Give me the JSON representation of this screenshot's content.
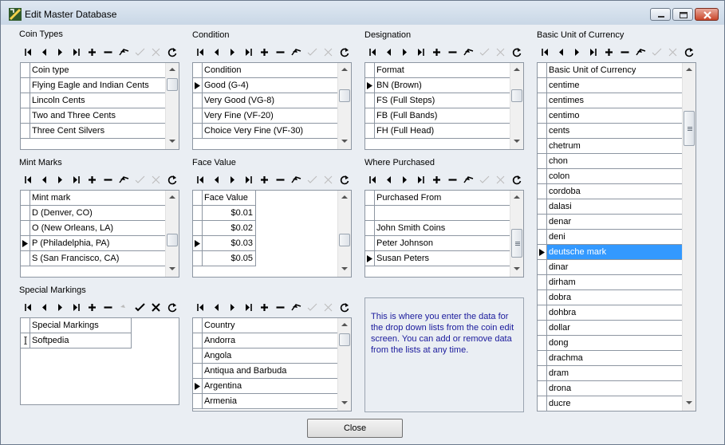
{
  "window": {
    "title": "Edit Master Database"
  },
  "panels": {
    "coin_types": {
      "label": "Coin Types",
      "header": "Coin type",
      "rows": [
        "Flying Eagle and Indian Cents",
        "Lincoln Cents",
        "Two and Three Cents",
        "Three Cent Silvers"
      ],
      "current_row": -1
    },
    "condition": {
      "label": "Condition",
      "header": "Condition",
      "rows": [
        "Good (G-4)",
        "Very Good (VG-8)",
        "Very Fine (VF-20)",
        "Choice Very Fine (VF-30)"
      ],
      "current_row": 0
    },
    "designation": {
      "label": "Designation",
      "header": "Format",
      "rows": [
        "BN (Brown)",
        "FS (Full Steps)",
        "FB (Full Bands)",
        "FH (Full Head)"
      ],
      "current_row": 0
    },
    "mint_marks": {
      "label": "Mint Marks",
      "header": "Mint mark",
      "rows": [
        "D (Denver, CO)",
        "O (New Orleans, LA)",
        "P (Philadelphia, PA)",
        "S (San Francisco, CA)"
      ],
      "current_row": 2
    },
    "face_value": {
      "label": "Face Value",
      "header": "Face Value",
      "rows": [
        "$0.01",
        "$0.02",
        "$0.03",
        "$0.05"
      ],
      "current_row": 2
    },
    "where_purchased": {
      "label": "Where Purchased",
      "header": "Purchased From",
      "rows": [
        "",
        "John Smith Coins",
        "Peter Johnson",
        "Susan Peters"
      ],
      "current_row": 3
    },
    "special_markings": {
      "label": "Special Markings",
      "header": "Special Markings",
      "rows": [
        "Softpedia"
      ],
      "current_row": 0
    },
    "country": {
      "label": "",
      "header": "Country",
      "rows": [
        "Andorra",
        "Angola",
        "Antiqua and Barbuda",
        "Argentina",
        "Armenia"
      ],
      "current_row": 3
    },
    "currency": {
      "label": "Basic Unit of Currency",
      "header": "Basic Unit of Currency",
      "rows": [
        "centime",
        "centimes",
        "centimo",
        "cents",
        "chetrum",
        "chon",
        "colon",
        "cordoba",
        "dalasi",
        "denar",
        "deni",
        "deutsche mark",
        "dinar",
        "dirham",
        "dobra",
        "dohbra",
        "dollar",
        "dong",
        "drachma",
        "dram",
        "drona",
        "ducre"
      ],
      "current_row": 11
    }
  },
  "info_text": "This is where you enter the data for the drop down lists from the coin edit screen.  You can add or remove data from the lists at any time.",
  "close_label": "Close",
  "nav_icons": [
    "first-icon",
    "prior-icon",
    "next-icon",
    "last-icon",
    "insert-icon",
    "delete-icon",
    "edit-icon",
    "post-icon",
    "cancel-icon",
    "refresh-icon"
  ],
  "colors": {
    "selection": "#3399ff",
    "info_text": "#1a1a9c",
    "window_bg": "#eaeef3"
  }
}
